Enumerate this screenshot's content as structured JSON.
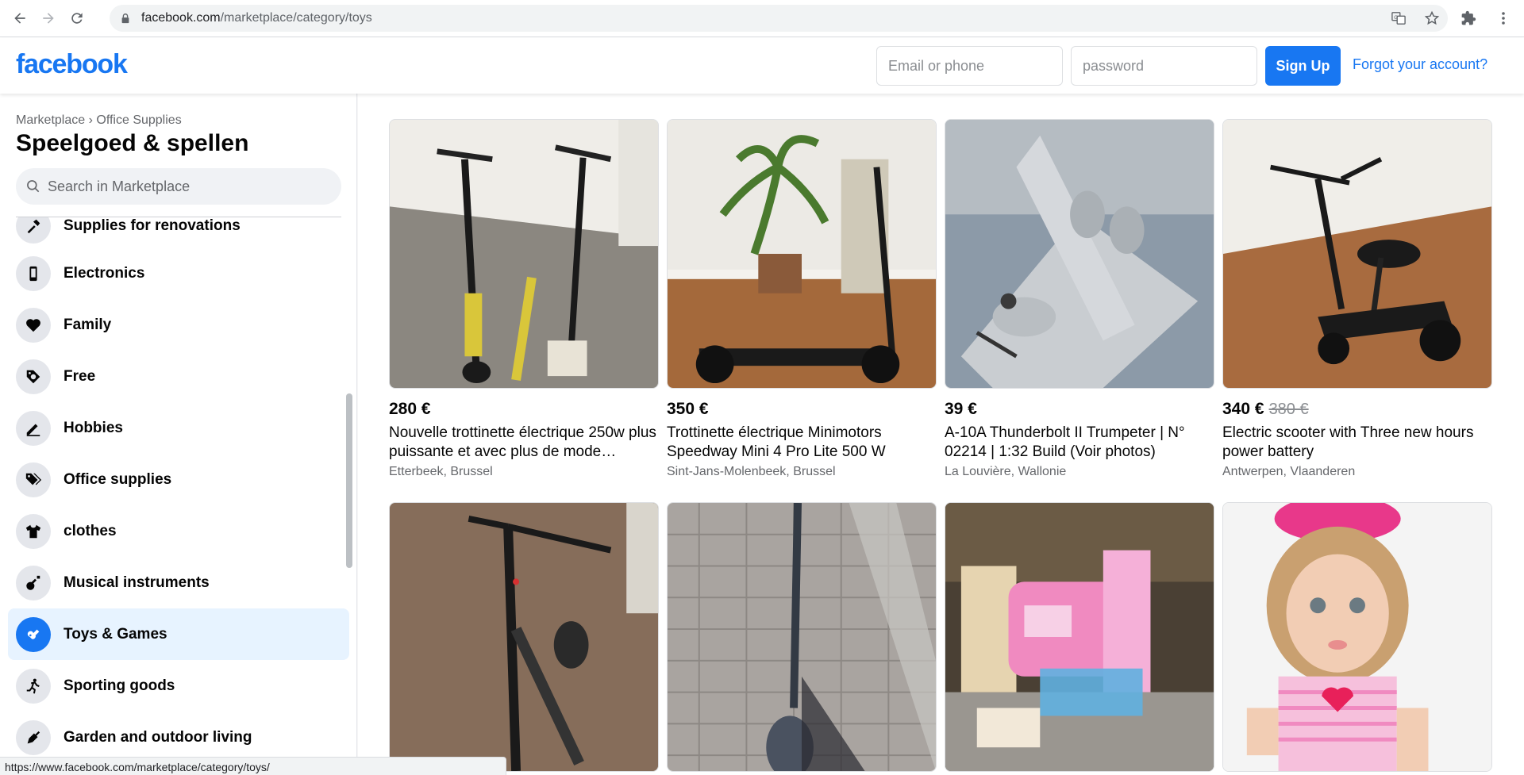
{
  "browser": {
    "url_host": "facebook.com",
    "url_path": "/marketplace/category/toys"
  },
  "header": {
    "logo": "facebook",
    "email_placeholder": "Email or phone",
    "password_placeholder": "password",
    "signup_label": "Sign Up",
    "forgot_label": "Forgot your account?"
  },
  "sidebar": {
    "breadcrumb": "Marketplace › Office Supplies",
    "title": "Speelgoed & spellen",
    "search_placeholder": "Search in Marketplace",
    "items": [
      {
        "label": "Supplies for renovations",
        "icon": "hammer-icon"
      },
      {
        "label": "Electronics",
        "icon": "phone-icon"
      },
      {
        "label": "Family",
        "icon": "heart-icon"
      },
      {
        "label": "Free",
        "icon": "tag-icon"
      },
      {
        "label": "Hobbies",
        "icon": "pen-icon"
      },
      {
        "label": "Office supplies",
        "icon": "price-tags-icon"
      },
      {
        "label": "clothes",
        "icon": "shirt-icon"
      },
      {
        "label": "Musical instruments",
        "icon": "guitar-icon"
      },
      {
        "label": "Toys & Games",
        "icon": "gamepad-icon",
        "active": true
      },
      {
        "label": "Sporting goods",
        "icon": "running-icon"
      },
      {
        "label": "Garden and outdoor living",
        "icon": "shovel-icon"
      }
    ]
  },
  "listings": [
    {
      "price": "280 €",
      "title": "Nouvelle trottinette électrique 250w plus puissante et avec plus de mode…",
      "location": "Etterbeek, Brussel"
    },
    {
      "price": "350 €",
      "title": "Trottinette électrique Minimotors Speedway Mini 4 Pro Lite 500 W",
      "location": "Sint-Jans-Molenbeek, Brussel"
    },
    {
      "price": "39 €",
      "title": "A-10A Thunderbolt II Trumpeter | N° 02214 | 1:32 Build (Voir photos)",
      "location": "La Louvière, Wallonie"
    },
    {
      "price": "340 €",
      "old_price": "380 €",
      "title": "Electric scooter with Three new hours power battery",
      "location": "Antwerpen, Vlaanderen"
    }
  ],
  "status_url": "https://www.facebook.com/marketplace/category/toys/",
  "colors": {
    "brand": "#1877f2",
    "active_bg": "#e7f3ff"
  }
}
